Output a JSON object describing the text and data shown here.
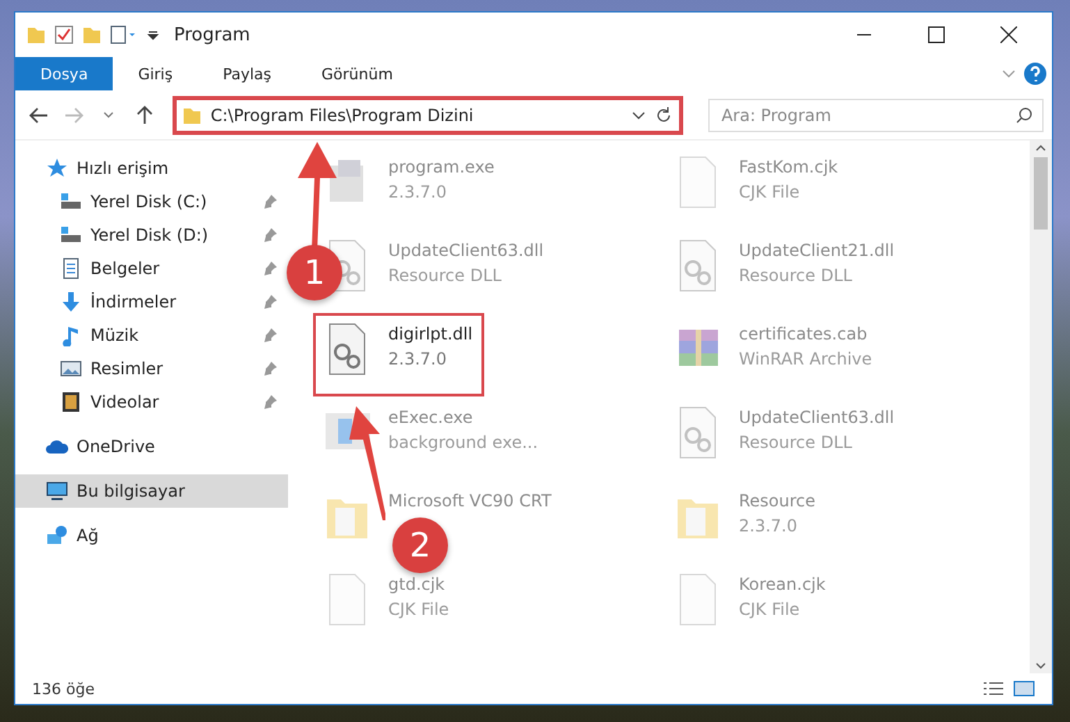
{
  "window": {
    "title": "Program"
  },
  "ribbon_tabs": [
    {
      "label": "Dosya",
      "selected": true
    },
    {
      "label": "Giriş",
      "selected": false
    },
    {
      "label": "Paylaş",
      "selected": false
    },
    {
      "label": "Görünüm",
      "selected": false
    }
  ],
  "address_bar": {
    "path": "C:\\Program Files\\Program Dizini",
    "highlighted": true
  },
  "search": {
    "placeholder": "Ara: Program"
  },
  "sidebar": {
    "items": [
      {
        "label": "Hızlı erişim",
        "kind": "star",
        "pinned": false,
        "selected": false,
        "children": [
          {
            "label": "Yerel Disk (C:)",
            "kind": "drive",
            "pinned": true,
            "selected": false
          },
          {
            "label": "Yerel Disk (D:)",
            "kind": "drive",
            "pinned": true,
            "selected": false
          },
          {
            "label": "Belgeler",
            "kind": "document",
            "pinned": true,
            "selected": false
          },
          {
            "label": "İndirmeler",
            "kind": "download",
            "pinned": true,
            "selected": false
          },
          {
            "label": "Müzik",
            "kind": "music",
            "pinned": true,
            "selected": false
          },
          {
            "label": "Resimler",
            "kind": "picture",
            "pinned": true,
            "selected": false
          },
          {
            "label": "Videolar",
            "kind": "video",
            "pinned": true,
            "selected": false
          }
        ]
      },
      {
        "label": "OneDrive",
        "kind": "cloud",
        "pinned": false,
        "selected": false
      },
      {
        "label": "Bu bilgisayar",
        "kind": "computer",
        "pinned": false,
        "selected": true
      },
      {
        "label": "Ağ",
        "kind": "network",
        "pinned": false,
        "selected": false
      }
    ]
  },
  "files": [
    {
      "name": "program.exe",
      "detail": "2.3.7.0",
      "kind": "exe",
      "blurred": true,
      "highlighted": false
    },
    {
      "name": "FastKom.cjk",
      "detail": "CJK File",
      "kind": "blank",
      "blurred": true,
      "highlighted": false
    },
    {
      "name": "UpdateClient63.dll",
      "detail": "Resource DLL",
      "kind": "dll",
      "blurred": true,
      "highlighted": false
    },
    {
      "name": "UpdateClient21.dll",
      "detail": "Resource DLL",
      "kind": "dll",
      "blurred": true,
      "highlighted": false
    },
    {
      "name": "digirlpt.dll",
      "detail": "2.3.7.0",
      "kind": "dll",
      "blurred": false,
      "highlighted": true
    },
    {
      "name": "certificates.cab",
      "detail": "WinRAR Archive",
      "kind": "archive",
      "blurred": true,
      "highlighted": false
    },
    {
      "name": "eExec.exe",
      "detail": "background exe...",
      "kind": "app",
      "blurred": true,
      "highlighted": false
    },
    {
      "name": "UpdateClient63.dll",
      "detail": "Resource DLL",
      "kind": "dll",
      "blurred": true,
      "highlighted": false
    },
    {
      "name": "Microsoft VC90 CRT",
      "kind": "folder",
      "blurred": true,
      "highlighted": false
    },
    {
      "name": "Resource",
      "detail": "2.3.7.0",
      "kind": "folder",
      "blurred": true,
      "highlighted": false
    },
    {
      "name": "gtd.cjk",
      "detail": "CJK File",
      "kind": "blank",
      "blurred": true,
      "highlighted": false
    },
    {
      "name": "Korean.cjk",
      "detail": "CJK File",
      "kind": "blank",
      "blurred": true,
      "highlighted": false
    }
  ],
  "status_bar": {
    "count": "136 öğe"
  },
  "callouts": [
    {
      "number": "1"
    },
    {
      "number": "2"
    }
  ]
}
